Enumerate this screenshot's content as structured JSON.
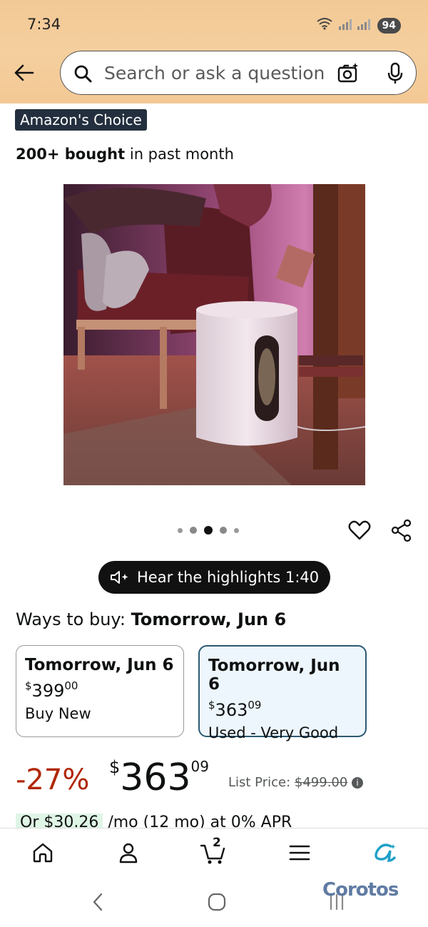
{
  "status_bar": {
    "time": "7:34",
    "battery": "94"
  },
  "search": {
    "placeholder": "Search or ask a question"
  },
  "product": {
    "badge": "Amazon's Choice",
    "bought_bold": "200+ bought",
    "bought_rest": " in past month"
  },
  "gallery": {
    "dot_count": 5,
    "active_index": 2
  },
  "highlights": {
    "label": "Hear the highlights 1:40"
  },
  "ways_to_buy": {
    "prefix": "Ways to buy: ",
    "date": "Tomorrow, Jun 6",
    "options": [
      {
        "date": "Tomorrow, Jun 6",
        "currency": "$",
        "dollars": "399",
        "cents": "00",
        "condition": "Buy New",
        "selected": false
      },
      {
        "date": "Tomorrow, Jun 6",
        "currency": "$",
        "dollars": "363",
        "cents": "09",
        "condition": "Used - Very Good",
        "selected": true
      }
    ]
  },
  "price": {
    "discount": "-27%",
    "currency": "$",
    "dollars": "363",
    "cents": "09",
    "list_label": "List Price: ",
    "list_value": "$499.00"
  },
  "financing": {
    "highlight": "Or $30.26",
    "rest": " /mo (12 mo) at 0% APR"
  },
  "bottom_nav": {
    "items": [
      "home-icon",
      "account-icon",
      "cart-icon",
      "menu-icon",
      "rufus-icon"
    ],
    "cart_count": "2"
  },
  "watermark": "Corotos",
  "colors": {
    "header": "#f3c895",
    "discount": "#b12704",
    "selected_card_border": "#2b5a73",
    "badge_bg": "#232f3e"
  }
}
